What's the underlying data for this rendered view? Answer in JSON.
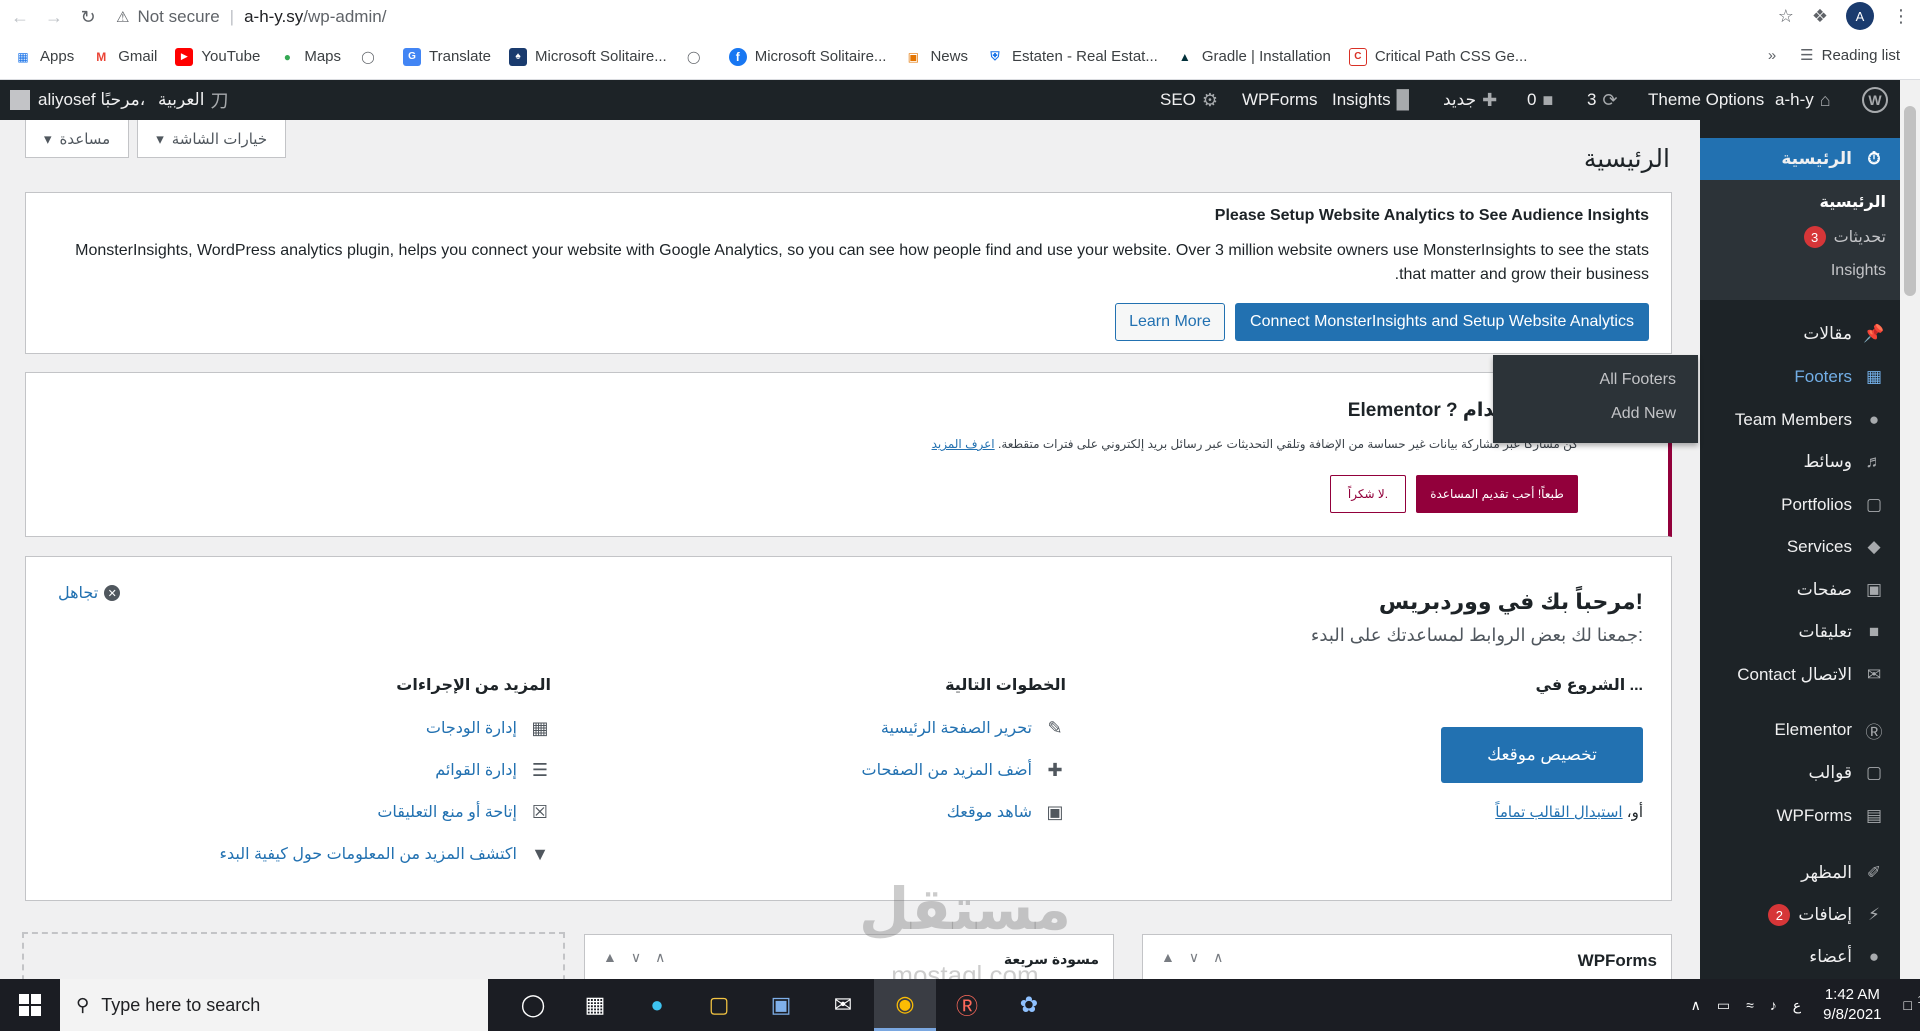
{
  "browser": {
    "security_label": "Not secure",
    "url_host": "a-h-y.sy",
    "url_path": "/wp-admin/",
    "profile_initial": "A"
  },
  "bookmarks": {
    "items": [
      {
        "label": "Apps",
        "icon": "apps-grid-icon"
      },
      {
        "label": "Gmail",
        "icon": "gmail-icon"
      },
      {
        "label": "YouTube",
        "icon": "youtube-icon"
      },
      {
        "label": "Maps",
        "icon": "maps-icon"
      },
      {
        "label": "",
        "icon": "globe-icon"
      },
      {
        "label": "Translate",
        "icon": "translate-icon"
      },
      {
        "label": "Microsoft Solitaire...",
        "icon": "solitaire-icon"
      },
      {
        "label": "",
        "icon": "globe-icon"
      },
      {
        "label": "Microsoft Solitaire...",
        "icon": "facebook-icon"
      },
      {
        "label": "News",
        "icon": "news-icon"
      },
      {
        "label": "Estaten - Real Estat...",
        "icon": "shield-icon"
      },
      {
        "label": "Gradle | Installation",
        "icon": "gradle-icon"
      },
      {
        "label": "Critical Path CSS Ge...",
        "icon": "css-icon"
      }
    ],
    "more_label": "»",
    "reading_list": "Reading list"
  },
  "adminbar": {
    "user": "aliyosef",
    "greeting": "مرحبًا،",
    "language": "العربية",
    "seo": "SEO",
    "wpforms": "WPForms",
    "insights": "Insights",
    "new": "جديد",
    "comments_count": "0",
    "updates_count": "3",
    "theme_options": "Theme Options",
    "site_name": "a-h-y"
  },
  "screen_meta": {
    "help": "مساعدة",
    "screen_options": "خيارات الشاشة"
  },
  "page_title": "الرئيسية",
  "sidebar": {
    "dashboard": "الرئيسية",
    "sub_home": "الرئيسية",
    "sub_updates": "تحديثات",
    "sub_updates_badge": "3",
    "sub_insights": "Insights",
    "items": [
      {
        "label": "مقالات",
        "icon": "pin-icon"
      },
      {
        "label": "Footers",
        "icon": "table-icon"
      },
      {
        "label": "Team Members",
        "icon": "person-icon"
      },
      {
        "label": "وسائط",
        "icon": "media-icon"
      },
      {
        "label": "Portfolios",
        "icon": "folder-icon"
      },
      {
        "label": "Services",
        "icon": "tag-icon"
      },
      {
        "label": "صفحات",
        "icon": "pages-icon"
      },
      {
        "label": "تعليقات",
        "icon": "comment-icon"
      },
      {
        "label": "Contact الاتصال",
        "icon": "mail-icon"
      },
      {
        "label": "Elementor",
        "icon": "elementor-icon"
      },
      {
        "label": "قوالب",
        "icon": "folder-icon"
      },
      {
        "label": "WPForms",
        "icon": "form-icon"
      },
      {
        "label": "المظهر",
        "icon": "brush-icon"
      },
      {
        "label": "إضافات",
        "icon": "plugin-icon",
        "badge": "2"
      },
      {
        "label": "أعضاء",
        "icon": "user-icon"
      }
    ],
    "flyout": {
      "all_footers": "All Footers",
      "add_new": "Add New"
    }
  },
  "analytics_notice": {
    "title": "Please Setup Website Analytics to See Audience Insights",
    "body_line1": "MonsterInsights, WordPress analytics plugin, helps you connect your website with Google Analytics, so you can see how people find and use your website. Over 3 million website owners use MonsterInsights to see the stats",
    "body_line2": ".that matter and grow their business",
    "connect_button": "Connect MonsterInsights and Setup Website Analytics",
    "learn_more_button": "Learn More"
  },
  "elementor_notice": {
    "title_prefix": "خدام",
    "title_brand": "Elementor ?",
    "text": "كن مشاركاً عبر مشاركة بيانات غير حساسة من الإضافة وتلقي التحديثات عبر رسائل بريد إلكتروني على فترات متقطعة.",
    "learn_link": "اعرف المزيد",
    "accept_button": "طبعاً! أحب تقديم المساعدة",
    "decline_button": "لا شكراً."
  },
  "welcome_panel": {
    "title": "مرحباً بك في ووردبريس!",
    "subtitle": "جمعنا لك بعض الروابط لمساعدتك على البدء:",
    "dismiss": "تجاهل",
    "col1_title": "الشروع في ...",
    "customize_button": "تخصيص موقعك",
    "or_prefix": "أو،",
    "replace_theme_link": "استبدال القالب تماماً",
    "col2_title": "الخطوات التالية",
    "col2_links": [
      {
        "label": "تحرير الصفحة الرئيسية",
        "icon": "edit-icon"
      },
      {
        "label": "أضف المزيد من الصفحات",
        "icon": "plus-icon"
      },
      {
        "label": "شاهد موقعك",
        "icon": "view-icon"
      }
    ],
    "col3_title": "المزيد من الإجراءات",
    "col3_links": [
      {
        "label": "إدارة الودجات",
        "icon": "widgets-icon"
      },
      {
        "label": "إدارة القوائم",
        "icon": "menus-icon"
      },
      {
        "label": "إتاحة أو منع التعليقات",
        "icon": "comments-toggle-icon"
      },
      {
        "label": "اكتشف المزيد من المعلومات حول كيفية البدء",
        "icon": "learn-icon"
      }
    ]
  },
  "postboxes": {
    "wpforms_title": "WPForms",
    "quick_draft_title": "مسودة سريعة"
  },
  "watermark": {
    "arabic": "مستقل",
    "latin": "mostaql.com"
  },
  "taskbar": {
    "search_placeholder": "Type here to search",
    "time": "1:42 AM",
    "date": "9/8/2021",
    "lang": "ع",
    "notifications": "1"
  }
}
